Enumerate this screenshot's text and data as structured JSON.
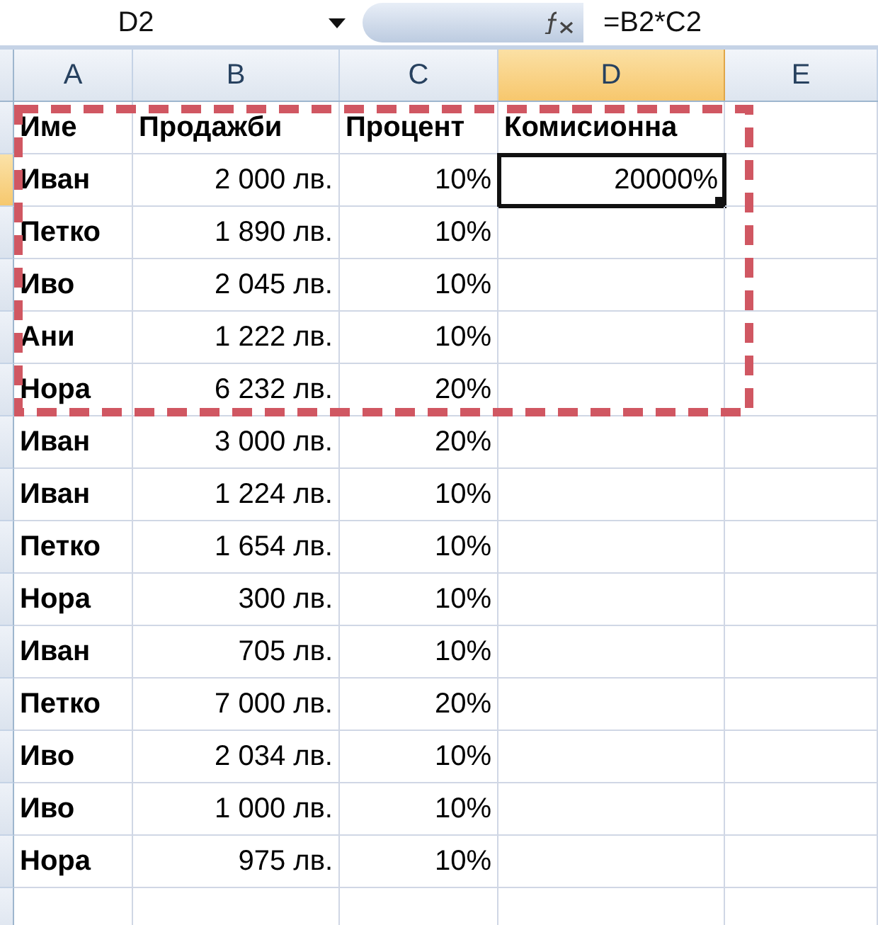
{
  "formula_bar": {
    "name_box": "D2",
    "formula": "=B2*C2"
  },
  "columns": [
    {
      "label": "A",
      "selected": false
    },
    {
      "label": "B",
      "selected": false
    },
    {
      "label": "C",
      "selected": false
    },
    {
      "label": "D",
      "selected": true
    },
    {
      "label": "E",
      "selected": false
    }
  ],
  "rows": [
    {
      "selected": false,
      "cells": [
        "Име",
        "Продажби",
        "Процент",
        "Комисионна"
      ]
    },
    {
      "selected": true,
      "cells": [
        "Иван",
        "2 000 лв.",
        "10%",
        "20000%"
      ]
    },
    {
      "selected": false,
      "cells": [
        "Петко",
        "1 890 лв.",
        "10%"
      ]
    },
    {
      "selected": false,
      "cells": [
        "Иво",
        "2 045 лв.",
        "10%"
      ]
    },
    {
      "selected": false,
      "cells": [
        "Ани",
        "1 222 лв.",
        "10%"
      ]
    },
    {
      "selected": false,
      "cells": [
        "Нора",
        "6 232 лв.",
        "20%"
      ]
    },
    {
      "selected": false,
      "cells": [
        "Иван",
        "3 000 лв.",
        "20%"
      ]
    },
    {
      "selected": false,
      "cells": [
        "Иван",
        "1 224 лв.",
        "10%"
      ]
    },
    {
      "selected": false,
      "cells": [
        "Петко",
        "1 654 лв.",
        "10%"
      ]
    },
    {
      "selected": false,
      "cells": [
        "Нора",
        "300 лв.",
        "10%"
      ]
    },
    {
      "selected": false,
      "cells": [
        "Иван",
        "705 лв.",
        "10%"
      ]
    },
    {
      "selected": false,
      "cells": [
        "Петко",
        "7 000 лв.",
        "20%"
      ]
    },
    {
      "selected": false,
      "cells": [
        "Иво",
        "2 034 лв.",
        "10%"
      ]
    },
    {
      "selected": false,
      "cells": [
        "Иво",
        "1 000 лв.",
        "10%"
      ]
    },
    {
      "selected": false,
      "cells": [
        "Нора",
        "975 лв.",
        "10%"
      ]
    },
    {
      "selected": false,
      "cells": []
    }
  ]
}
